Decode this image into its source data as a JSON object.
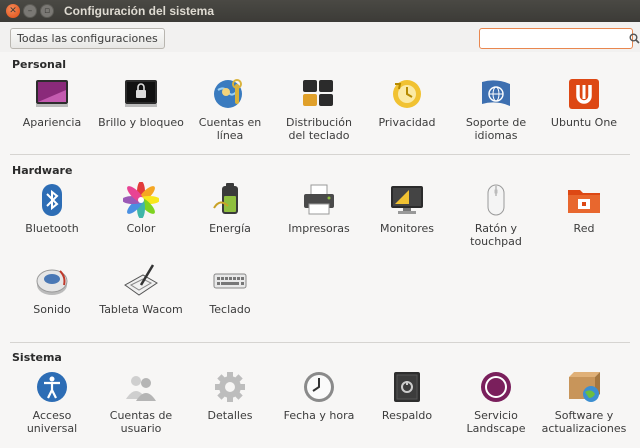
{
  "window": {
    "title": "Configuración del sistema"
  },
  "toolbar": {
    "all_settings_label": "Todas las configuraciones",
    "search_placeholder": "",
    "search_value": ""
  },
  "sections": {
    "personal": {
      "title": "Personal",
      "items": [
        {
          "label": "Apariencia",
          "icon": "appearance-icon"
        },
        {
          "label": "Brillo y bloqueo",
          "icon": "brightness-lock-icon"
        },
        {
          "label": "Cuentas en línea",
          "icon": "online-accounts-icon"
        },
        {
          "label": "Distribución del teclado",
          "icon": "keyboard-layout-icon"
        },
        {
          "label": "Privacidad",
          "icon": "privacy-icon"
        },
        {
          "label": "Soporte de idiomas",
          "icon": "language-support-icon"
        },
        {
          "label": "Ubuntu One",
          "icon": "ubuntu-one-icon"
        }
      ]
    },
    "hardware": {
      "title": "Hardware",
      "items": [
        {
          "label": "Bluetooth",
          "icon": "bluetooth-icon"
        },
        {
          "label": "Color",
          "icon": "color-icon"
        },
        {
          "label": "Energía",
          "icon": "power-icon"
        },
        {
          "label": "Impresoras",
          "icon": "printer-icon"
        },
        {
          "label": "Monitores",
          "icon": "monitor-icon"
        },
        {
          "label": "Ratón y touchpad",
          "icon": "mouse-icon"
        },
        {
          "label": "Red",
          "icon": "network-icon"
        },
        {
          "label": "Sonido",
          "icon": "sound-icon"
        },
        {
          "label": "Tableta Wacom",
          "icon": "wacom-tablet-icon"
        },
        {
          "label": "Teclado",
          "icon": "keyboard-icon"
        }
      ]
    },
    "system": {
      "title": "Sistema",
      "items": [
        {
          "label": "Acceso universal",
          "icon": "universal-access-icon"
        },
        {
          "label": "Cuentas de usuario",
          "icon": "user-accounts-icon"
        },
        {
          "label": "Detalles",
          "icon": "details-icon"
        },
        {
          "label": "Fecha y hora",
          "icon": "clock-icon"
        },
        {
          "label": "Respaldo",
          "icon": "backup-icon"
        },
        {
          "label": "Servicio Landscape",
          "icon": "landscape-icon"
        },
        {
          "label": "Software y actualizaciones",
          "icon": "software-updates-icon"
        }
      ]
    }
  },
  "colors": {
    "accent": "#dd4814",
    "titlebar": "#3c3b37"
  }
}
